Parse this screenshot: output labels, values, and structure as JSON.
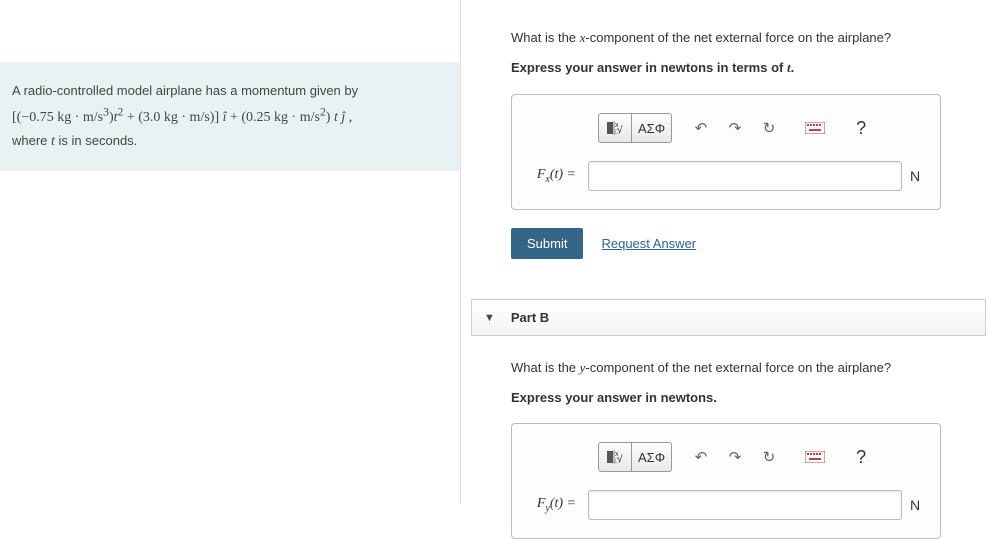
{
  "problem": {
    "intro": "A radio-controlled model airplane has a momentum given by",
    "formula": "[(−0.75 kg · m/s³)t² + (3.0 kg · m/s)] î + (0.25 kg · m/s²)t ĵ ,",
    "tail": "where t is in seconds."
  },
  "partA": {
    "question_pre": "What is the ",
    "question_var": "x",
    "question_post": "-component of the net external force on the airplane?",
    "instruction_pre": "Express your answer in newtons in terms of ",
    "instruction_var": "t",
    "instruction_post": ".",
    "answer_label": "Fₓ(t) =",
    "unit": "N",
    "submit": "Submit",
    "request": "Request Answer",
    "toolbar": {
      "greek": "ΑΣΦ"
    }
  },
  "partB": {
    "header": "Part B",
    "question_pre": "What is the ",
    "question_var": "y",
    "question_post": "-component of the net external force on the airplane?",
    "instruction": "Express your answer in newtons.",
    "answer_label_html": "F_y(t) =",
    "unit": "N",
    "toolbar": {
      "greek": "ΑΣΦ"
    }
  }
}
